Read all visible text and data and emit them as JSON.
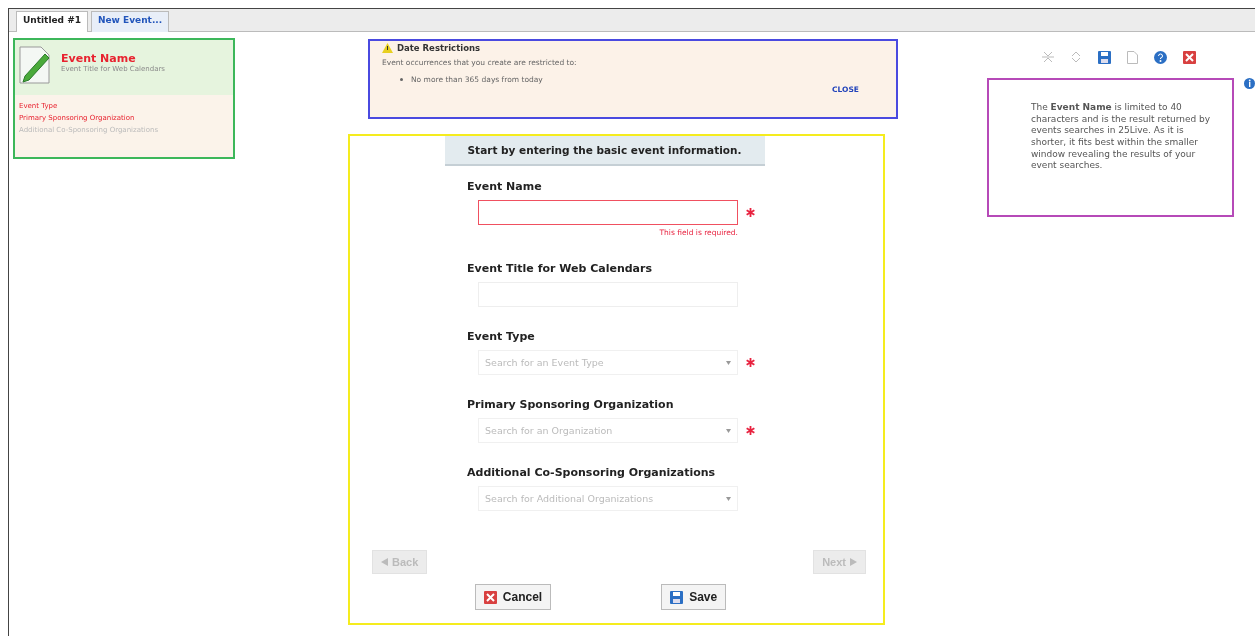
{
  "tabs": [
    {
      "label": "Untitled #1",
      "selected": true
    },
    {
      "label": "New Event...",
      "selected": false
    }
  ],
  "summary": {
    "title": "Event Name",
    "subtitle": "Event Title for Web Calendars",
    "items": [
      {
        "label": "Event Type",
        "required": true
      },
      {
        "label": "Primary Sponsoring Organization",
        "required": true
      },
      {
        "label": "Additional Co-Sponsoring Organizations",
        "required": false
      }
    ]
  },
  "date_restrictions": {
    "title": "Date Restrictions",
    "text": "Event occurrences that you create are restricted to:",
    "rules": [
      "No more than 365 days from today"
    ],
    "close": "CLOSE"
  },
  "form": {
    "heading": "Start by entering the basic event information.",
    "fields": [
      {
        "label": "Event Name",
        "kind": "text",
        "required": true,
        "invalid": true,
        "error": "This field is required."
      },
      {
        "label": "Event Title for Web Calendars",
        "kind": "text",
        "required": false,
        "invalid": false
      },
      {
        "label": "Event Type",
        "kind": "select",
        "placeholder": "Search for an Event Type",
        "required": true,
        "invalid": false
      },
      {
        "label": "Primary Sponsoring Organization",
        "kind": "select",
        "placeholder": "Search for an Organization",
        "required": true,
        "invalid": false
      },
      {
        "label": "Additional Co-Sponsoring Organizations",
        "kind": "select",
        "placeholder": "Search for Additional Organizations",
        "required": false,
        "invalid": false
      }
    ],
    "back": {
      "label": "Back",
      "disabled": true
    },
    "next": {
      "label": "Next",
      "disabled": true
    },
    "cancel": "Cancel",
    "save": "Save"
  },
  "help": {
    "text": "The **Event Name** is limited to 40 characters and is the result returned by events searches in 25Live. As it is shorter, it fits best within the smaller window revealing the results of your event searches."
  }
}
